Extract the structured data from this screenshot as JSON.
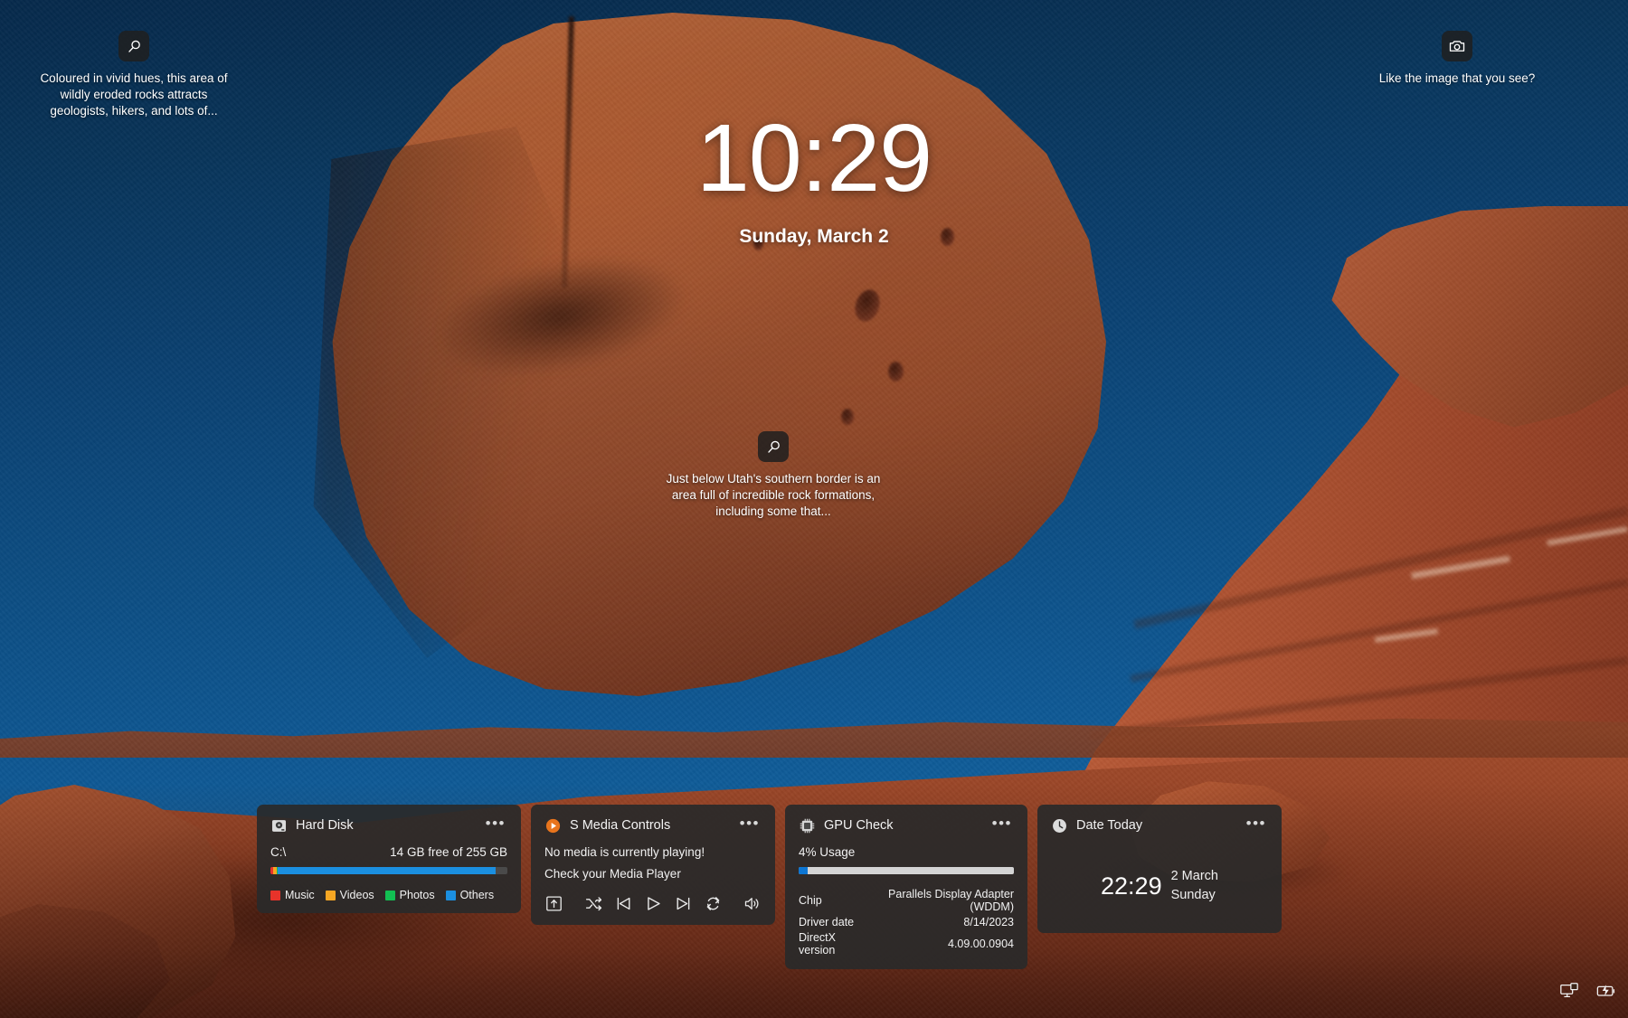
{
  "wallpaper": {
    "scene": "balanced-rock-red-sandstone-desert",
    "sky_color": "#0c4e84",
    "rock_color": "#a85a32"
  },
  "clock": {
    "time": "10:29",
    "date": "Sunday, March 2"
  },
  "spotlight": {
    "top_left": {
      "icon": "search-icon",
      "text": "Coloured in vivid hues, this area of wildly eroded rocks attracts geologists, hikers, and lots of..."
    },
    "top_right": {
      "icon": "camera-icon",
      "text": "Like the image that you see?"
    },
    "center": {
      "icon": "search-icon",
      "text": "Just below Utah's southern border is an area full of incredible rock formations, including some that..."
    }
  },
  "widgets": {
    "more_label": "•••",
    "hard_disk": {
      "icon": "hard-disk-icon",
      "title": "Hard Disk",
      "drive": "C:\\",
      "capacity_text": "14 GB free of 255 GB",
      "segments": [
        {
          "label": "Music",
          "color": "#e8332a",
          "percent": 1.2
        },
        {
          "label": "Videos",
          "color": "#f5a623",
          "percent": 1.6
        },
        {
          "label": "Photos",
          "color": "#12bf52",
          "percent": 0.4
        },
        {
          "label": "Others",
          "color": "#1b8fe0",
          "percent": 91.8
        }
      ],
      "free_percent": 5.0,
      "track_color": "#4a4a4a"
    },
    "media": {
      "icon": "media-play-badge-icon",
      "title": "S Media Controls",
      "line1": "No media is currently playing!",
      "line2": "Check your Media Player",
      "controls": [
        "cast-icon",
        "shuffle-icon",
        "previous-icon",
        "play-icon",
        "next-icon",
        "repeat-icon",
        "volume-icon"
      ]
    },
    "gpu": {
      "icon": "gpu-chip-icon",
      "title": "GPU Check",
      "usage_text": "4% Usage",
      "usage_percent": 4,
      "bar_fill_color": "#0d76d3",
      "bar_track_color": "#d4d4d4",
      "rows": [
        {
          "label": "Chip",
          "value": "Parallels Display Adapter (WDDM)"
        },
        {
          "label": "Driver date",
          "value": "8/14/2023"
        },
        {
          "label": "DirectX version",
          "value": "4.09.00.0904"
        }
      ]
    },
    "date": {
      "icon": "clock-icon",
      "title": "Date Today",
      "time": "22:29",
      "day_month": "2 March",
      "weekday": "Sunday"
    }
  },
  "tray": {
    "items": [
      {
        "name": "display-settings-icon"
      },
      {
        "name": "battery-charging-icon"
      }
    ]
  }
}
